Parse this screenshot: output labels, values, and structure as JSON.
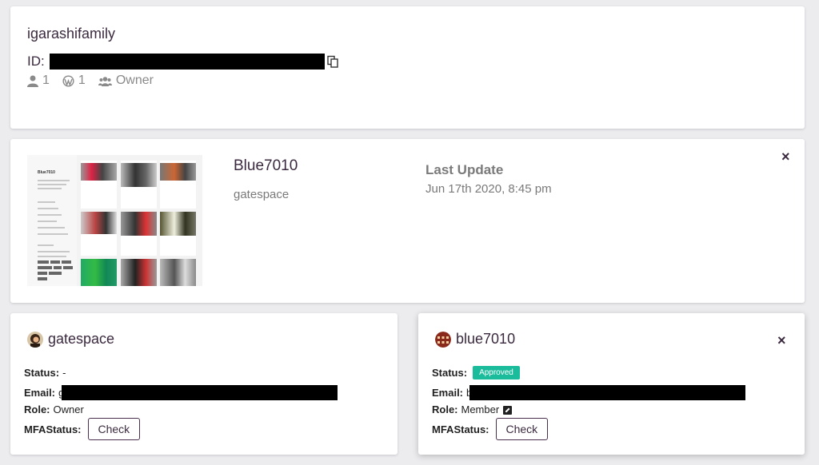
{
  "org": {
    "name": "igarashifamily",
    "id_label": "ID:",
    "members_count": "1",
    "sites_count": "1",
    "role": "Owner"
  },
  "site": {
    "name": "Blue7010",
    "owner": "gatespace",
    "last_update_label": "Last Update",
    "last_update_value": "Jun 17th 2020, 8:45 pm",
    "close_label": "×",
    "thumbnail_title": "Blue7010"
  },
  "users": [
    {
      "name": "gatespace",
      "status_label": "Status:",
      "status_value": "-",
      "email_label": "Email:",
      "email_prefix": "g",
      "role_label": "Role:",
      "role_value": "Owner",
      "mfa_label": "MFAStatus:",
      "check_label": "Check"
    },
    {
      "name": "blue7010",
      "status_label": "Status:",
      "status_badge": "Approved",
      "email_label": "Email:",
      "email_prefix": "b",
      "role_label": "Role:",
      "role_value": "Member",
      "mfa_label": "MFAStatus:",
      "check_label": "Check",
      "close_label": "×"
    }
  ],
  "colors": {
    "accent": "#3b2a3f",
    "approved_badge": "#1bbc9b",
    "muted_text": "#7a7a7a",
    "background": "#ececef"
  },
  "icons": [
    "copy-icon",
    "user-icon",
    "wordpress-icon",
    "users-icon",
    "close-icon",
    "edit-icon"
  ]
}
